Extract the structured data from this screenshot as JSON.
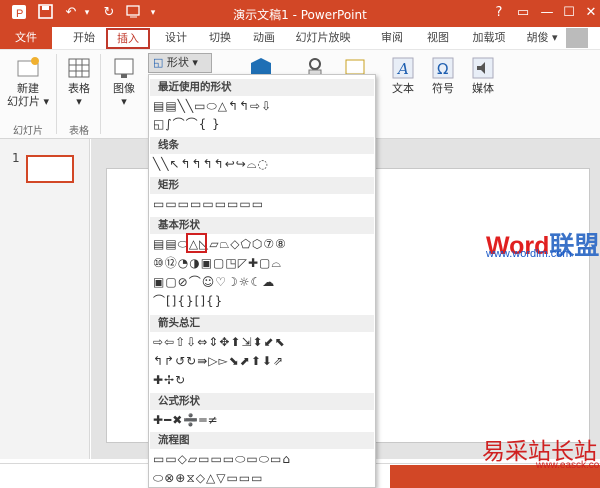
{
  "window": {
    "title": "演示文稿1 - PowerPoint"
  },
  "quick_access": {
    "save": "save-icon",
    "undo": "↶",
    "undo_more": "▾",
    "redo": "↻",
    "custom": "▾"
  },
  "window_controls": {
    "help": "?",
    "ribbon": "▭",
    "min": "—",
    "max": "☐",
    "close": "✕"
  },
  "tabs": [
    {
      "label": "文件"
    },
    {
      "label": "开始"
    },
    {
      "label": "插入"
    },
    {
      "label": "设计"
    },
    {
      "label": "切换"
    },
    {
      "label": "动画"
    },
    {
      "label": "幻灯片放映"
    },
    {
      "label": "审阅"
    },
    {
      "label": "视图"
    },
    {
      "label": "加载项"
    },
    {
      "label": "胡俊 ▾"
    }
  ],
  "ribbon": {
    "new_slide": "新建\n幻灯片 ▾",
    "table": "表格\n▾",
    "image": "图像\n▾",
    "shapes": "形状 ▾",
    "text": "文本",
    "symbols": "符号",
    "media": "媒体",
    "groups": {
      "slides": "幻灯片",
      "tables": "表格"
    }
  },
  "slides_panel": {
    "first_number": "1"
  },
  "shapes_dropdown": {
    "sections": [
      {
        "title": "最近使用的形状",
        "rows": [
          "▤▤╲╲▭⬭△↰↰⇨⇩",
          "◱∫⌒⌒{ }"
        ]
      },
      {
        "title": "线条",
        "rows": [
          "╲╲↖↰↰↰↰↩↪⌓◌"
        ]
      },
      {
        "title": "矩形",
        "rows": [
          "▭▭▭▭▭▭▭▭▭"
        ]
      },
      {
        "title": "基本形状",
        "rows": [
          "▤▤⬭△◺▱⏢◇⬠⬡⑦⑧",
          "⑩⑫◔◑▣▢◳◸✚▢⌓",
          "▣▢⊘⌒☺♡☽☼☾☁",
          "⌒[]{}[]{}"
        ]
      },
      {
        "title": "箭头总汇",
        "rows": [
          "⇨⇦⇧⇩⇔⇕✥⬆⇲⬍⬋⬉",
          "↰↱↺↻⇛▷▻⬊⬈⬆⬇⇗",
          "✚✢↻"
        ]
      },
      {
        "title": "公式形状",
        "rows": [
          "✚━✖➗═≠"
        ]
      },
      {
        "title": "流程图",
        "rows": [
          "▭▭◇▱▭▭▭⬭▭⬭▭⌂",
          "⬭⊗⊕⧖◇△▽▭▭▭"
        ]
      }
    ]
  },
  "watermark": {
    "word_w": "Word",
    "word_rest": "联盟",
    "url": "www.wordlm.com",
    "site": "易采站长站",
    "site_url": "www.easck.com"
  }
}
